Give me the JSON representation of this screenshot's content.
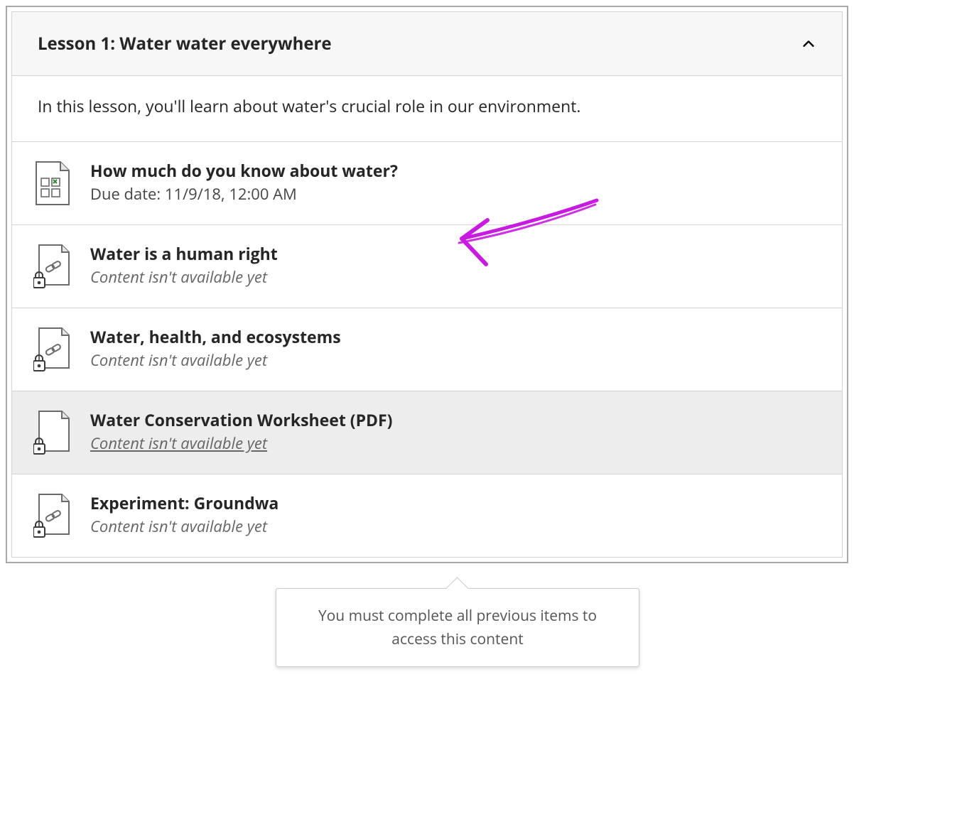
{
  "lesson": {
    "title": "Lesson 1: Water water everywhere",
    "intro": "In this lesson, you'll learn about water's crucial role in our environment."
  },
  "items": [
    {
      "title": "How much do you know about water?",
      "sub": "Due date: 11/9/18, 12:00 AM",
      "available": true,
      "icon": "test"
    },
    {
      "title": "Water is a human right",
      "sub": "Content isn't available yet",
      "available": false,
      "icon": "locked-link"
    },
    {
      "title": "Water, health, and ecosystems",
      "sub": "Content isn't available yet",
      "available": false,
      "icon": "locked-link"
    },
    {
      "title": "Water Conservation Worksheet (PDF)",
      "sub": "Content isn't available yet",
      "available": false,
      "icon": "locked-file",
      "hovered": true
    },
    {
      "title": "Experiment: Groundwa",
      "sub": "Content isn't available yet",
      "available": false,
      "icon": "locked-link"
    }
  ],
  "tooltip": "You must complete all previous items to access this content",
  "annotation": {
    "present": true,
    "color": "#c81be0"
  }
}
